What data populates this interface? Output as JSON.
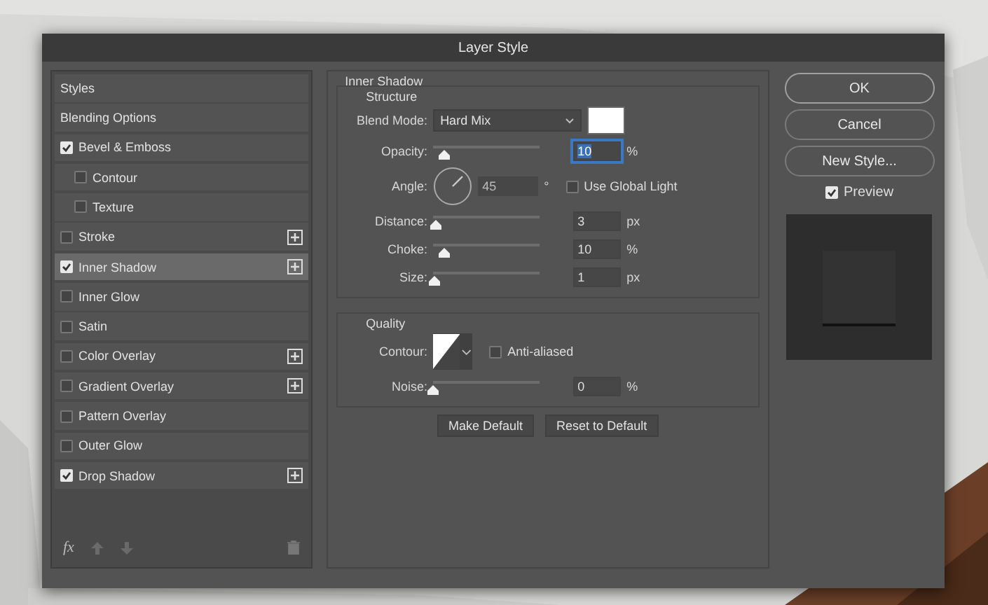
{
  "window": {
    "title": "Layer Style"
  },
  "styles": [
    {
      "label": "Styles",
      "kind": "heading",
      "selected": false
    },
    {
      "label": "Blending Options",
      "kind": "heading",
      "selected": false
    },
    {
      "label": "Bevel & Emboss",
      "kind": "effect",
      "checked": true,
      "selected": false,
      "add_button": false,
      "children": [
        {
          "label": "Contour",
          "checked": false,
          "selected": false,
          "add_button": false
        },
        {
          "label": "Texture",
          "checked": false,
          "selected": false,
          "add_button": false
        }
      ]
    },
    {
      "label": "Stroke",
      "kind": "effect",
      "checked": false,
      "selected": false,
      "add_button": true
    },
    {
      "label": "Inner Shadow",
      "kind": "effect",
      "checked": true,
      "selected": true,
      "add_button": true
    },
    {
      "label": "Inner Glow",
      "kind": "effect",
      "checked": false,
      "selected": false,
      "add_button": false
    },
    {
      "label": "Satin",
      "kind": "effect",
      "checked": false,
      "selected": false,
      "add_button": false
    },
    {
      "label": "Color Overlay",
      "kind": "effect",
      "checked": false,
      "selected": false,
      "add_button": true
    },
    {
      "label": "Gradient Overlay",
      "kind": "effect",
      "checked": false,
      "selected": false,
      "add_button": true
    },
    {
      "label": "Pattern Overlay",
      "kind": "effect",
      "checked": false,
      "selected": false,
      "add_button": false
    },
    {
      "label": "Outer Glow",
      "kind": "effect",
      "checked": false,
      "selected": false,
      "add_button": false
    },
    {
      "label": "Drop Shadow",
      "kind": "effect",
      "checked": true,
      "selected": false,
      "add_button": true
    }
  ],
  "styles_footer": {
    "fx": "fx"
  },
  "panel": {
    "title": "Inner Shadow",
    "structure": {
      "title": "Structure",
      "blend_mode_label": "Blend Mode:",
      "blend_mode": "Hard Mix",
      "rows": [
        {
          "kind": "slider",
          "label": "Opacity:",
          "value": "10",
          "unit": "%",
          "level": 0.1,
          "focused": true
        },
        {
          "kind": "angle",
          "label": "Angle:",
          "value": "45",
          "unit": "°",
          "global_light_label": "Use Global Light",
          "global_light": false
        },
        {
          "kind": "slider",
          "label": "Distance:",
          "value": "3",
          "unit": "px",
          "level": 0.03,
          "focused": false
        },
        {
          "kind": "slider",
          "label": "Choke:",
          "value": "10",
          "unit": "%",
          "level": 0.1,
          "focused": false
        },
        {
          "kind": "slider",
          "label": "Size:",
          "value": "1",
          "unit": "px",
          "level": 0.01,
          "focused": false
        }
      ]
    },
    "quality": {
      "title": "Quality",
      "contour_label": "Contour:",
      "anti_aliased_label": "Anti-aliased",
      "anti_aliased": false,
      "noise": {
        "label": "Noise:",
        "value": "0",
        "unit": "%",
        "level": 0.0
      }
    },
    "buttons": [
      "Make Default",
      "Reset to Default"
    ]
  },
  "actions": [
    {
      "label": "OK",
      "default": true
    },
    {
      "label": "Cancel",
      "default": false
    },
    {
      "label": "New Style...",
      "default": false
    }
  ],
  "preview": {
    "label": "Preview",
    "checked": true
  }
}
